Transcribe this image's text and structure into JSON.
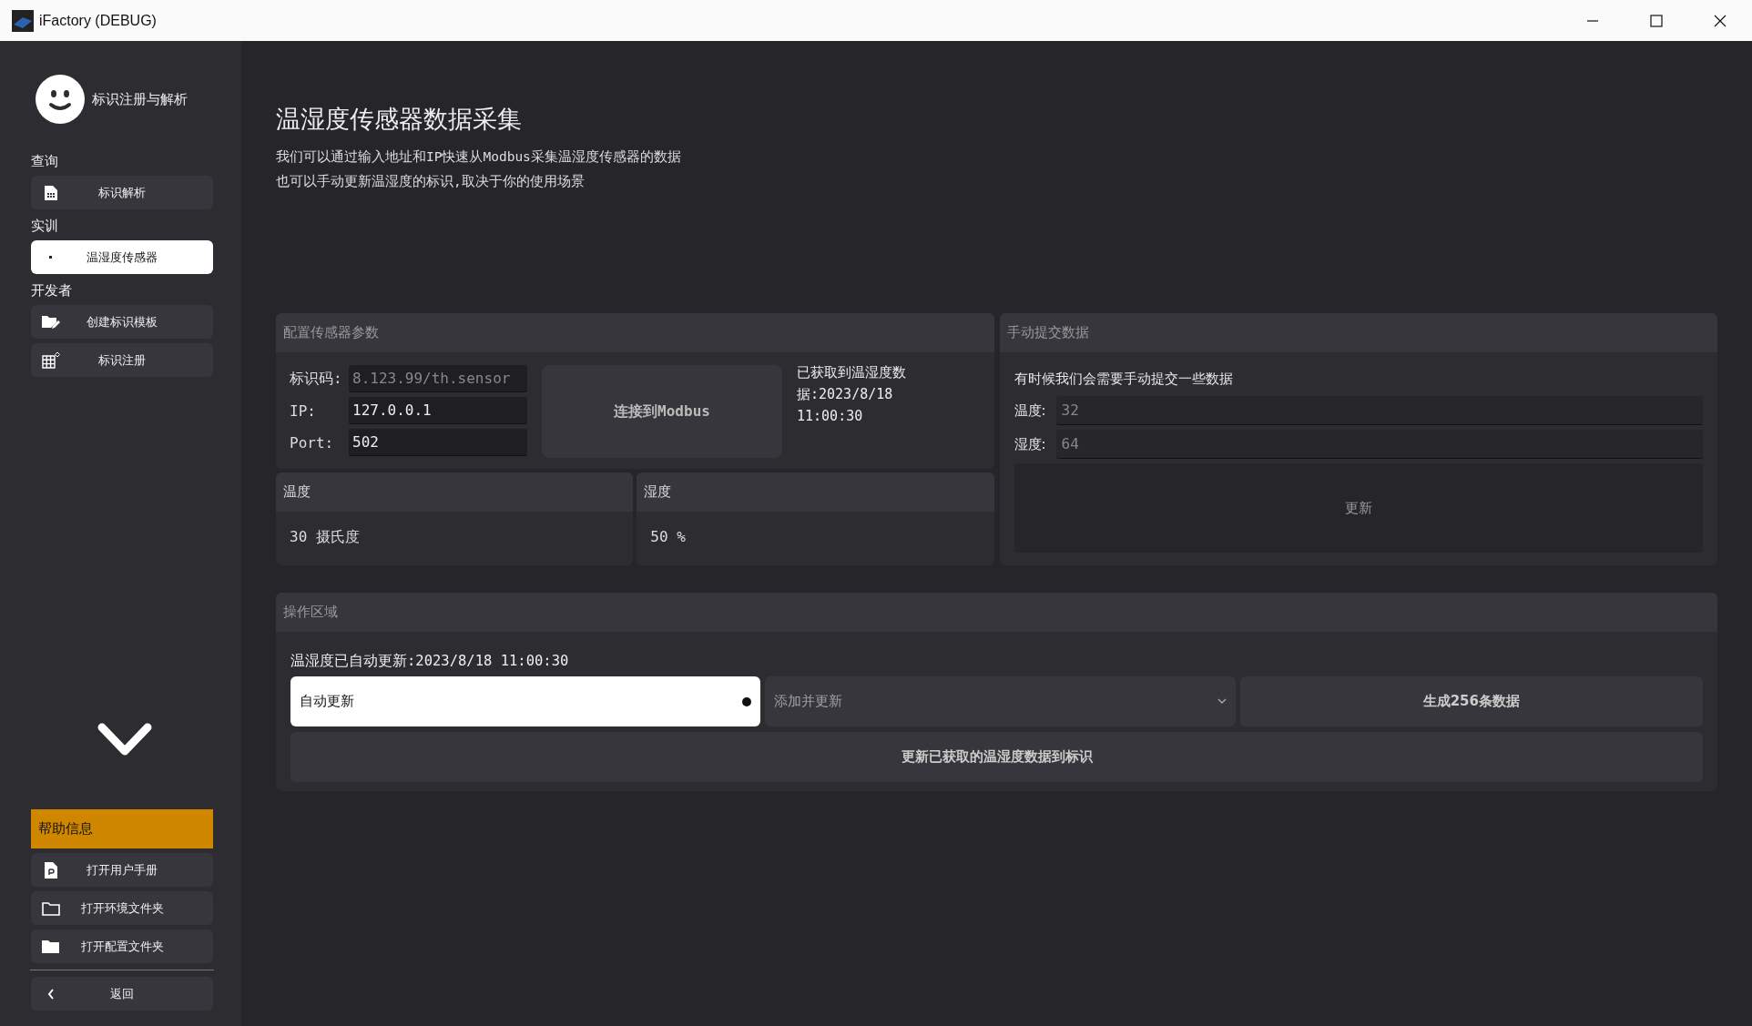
{
  "window": {
    "title": "iFactory (DEBUG)"
  },
  "sidebar": {
    "profile_name": "标识注册与解析",
    "sections": [
      {
        "heading": "查询",
        "items": [
          {
            "label": "标识解析",
            "kind": "sim",
            "selected": false
          }
        ]
      },
      {
        "heading": "实训",
        "items": [
          {
            "label": "温湿度传感器",
            "kind": "dot",
            "selected": true
          }
        ]
      },
      {
        "heading": "开发者",
        "items": [
          {
            "label": "创建标识模板",
            "kind": "folder-edit",
            "selected": false
          },
          {
            "label": "标识注册",
            "kind": "grid",
            "selected": false
          }
        ]
      }
    ],
    "help": {
      "heading": "帮助信息",
      "items": [
        {
          "label": "打开用户手册",
          "kind": "pdf"
        },
        {
          "label": "打开环境文件夹",
          "kind": "folder-outline"
        },
        {
          "label": "打开配置文件夹",
          "kind": "folder"
        }
      ]
    },
    "back": "返回"
  },
  "page": {
    "title": "温湿度传感器数据采集",
    "description": [
      "我们可以通过输入地址和IP快速从Modbus采集温湿度传感器的数据",
      "也可以手动更新温湿度的标识,取决于你的使用场景"
    ]
  },
  "config": {
    "title": "配置传感器参数",
    "fields": [
      {
        "label": "标识码:",
        "placeholder": "8.123.99/th.sensor"
      },
      {
        "label": "IP:",
        "value": "127.0.0.1"
      },
      {
        "label": "Port:",
        "value": "502"
      }
    ],
    "connect_button": "连接到Modbus",
    "status": "已获取到温湿度数据:2023/8/18 11:00:30"
  },
  "readings": [
    {
      "title": "温度",
      "value": "30 摄氏度"
    },
    {
      "title": "湿度",
      "value": "50 %"
    }
  ],
  "manual": {
    "title": "手动提交数据",
    "note": "有时候我们会需要手动提交一些数据",
    "fields": [
      {
        "label": "温度:",
        "placeholder": "32"
      },
      {
        "label": "湿度:",
        "placeholder": "64"
      }
    ],
    "button": {
      "label": "更新",
      "disabled": true
    }
  },
  "operations": {
    "title": "操作区域",
    "status": "温湿度已自动更新:2023/8/18 11:00:30",
    "toggle": {
      "label": "自动更新",
      "selected": true
    },
    "dropdown": {
      "value": "添加并更新"
    },
    "generate_button": "生成256条数据",
    "update_button": "更新已获取的温湿度数据到标识"
  }
}
